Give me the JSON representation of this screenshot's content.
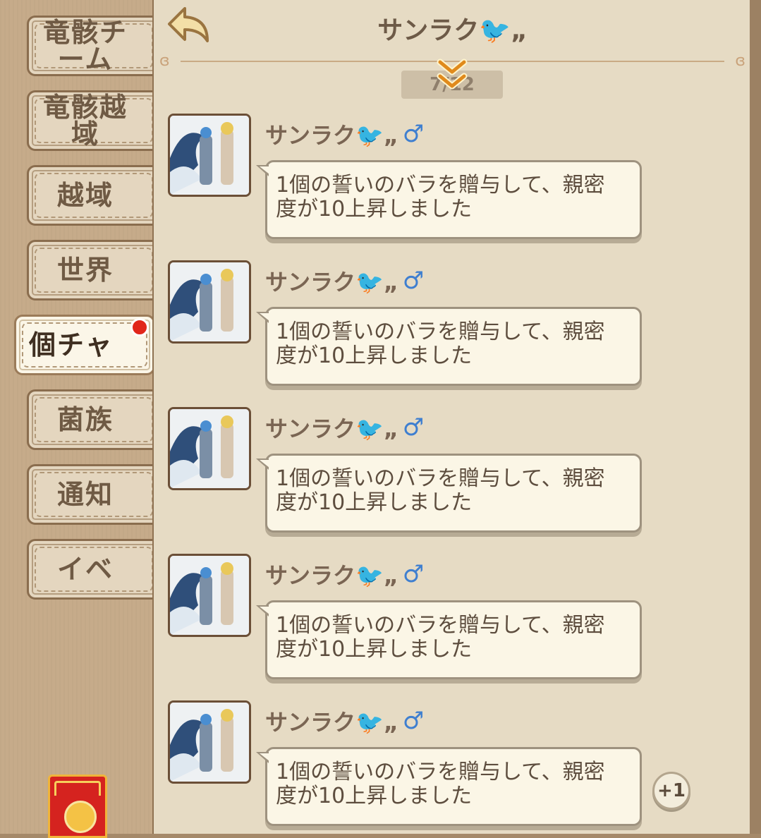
{
  "sidebar": {
    "tabs": [
      {
        "label": "竜骸チーム",
        "active": false
      },
      {
        "label": "竜骸越域",
        "active": false
      },
      {
        "label": "越域",
        "active": false
      },
      {
        "label": "世界",
        "active": false
      },
      {
        "label": "個チャ",
        "active": true,
        "has_notification": true
      },
      {
        "label": "菌族",
        "active": false
      },
      {
        "label": "通知",
        "active": false
      },
      {
        "label": "イベ",
        "active": false
      }
    ]
  },
  "header": {
    "title": "サンラク🐦„",
    "page_indicator": "7/12"
  },
  "messages": [
    {
      "sender": "サンラク🐦„",
      "gender": "♂",
      "text": "1個の誓いのバラを贈与して、親密度が10上昇しました"
    },
    {
      "sender": "サンラク🐦„",
      "gender": "♂",
      "text": "1個の誓いのバラを贈与して、親密度が10上昇しました"
    },
    {
      "sender": "サンラク🐦„",
      "gender": "♂",
      "text": "1個の誓いのバラを贈与して、親密度が10上昇しました"
    },
    {
      "sender": "サンラク🐦„",
      "gender": "♂",
      "text": "1個の誓いのバラを贈与して、親密度が10上昇しました"
    },
    {
      "sender": "サンラク🐦„",
      "gender": "♂",
      "text": "1個の誓いのバラを贈与して、親密度が10上昇しました"
    }
  ],
  "plus_badge": "+1",
  "colors": {
    "accent": "#e08a1c",
    "notification": "#e1261a",
    "gender_male": "#3f7fd0"
  }
}
